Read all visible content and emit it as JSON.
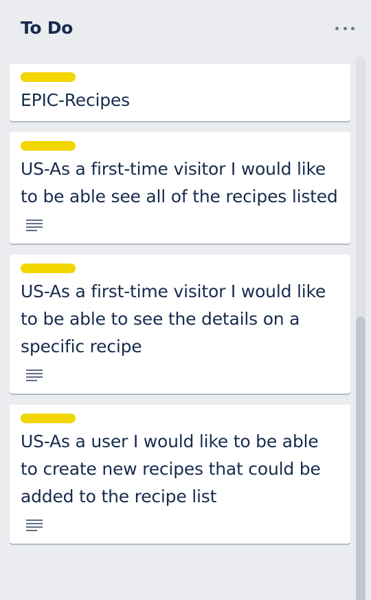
{
  "list": {
    "title": "To Do",
    "more_icon": "ellipsis-icon",
    "cards": [
      {
        "label_color": "#f2d600",
        "title": "EPIC-Recipes",
        "has_description": false
      },
      {
        "label_color": "#f2d600",
        "title": "US-As a first-time visitor I would like to be able see all of the recipes listed",
        "has_description": true
      },
      {
        "label_color": "#f2d600",
        "title": "US-As a first-time visitor I would like to be able to see the details on a specific recipe",
        "has_description": true
      },
      {
        "label_color": "#f2d600",
        "title": "US-As a user I would like to be able to create new recipes that could be added to the recipe list",
        "has_description": true
      }
    ]
  },
  "colors": {
    "background": "#ebecf0",
    "card": "#ffffff",
    "label_yellow": "#f2d600",
    "text": "#172b4d"
  }
}
